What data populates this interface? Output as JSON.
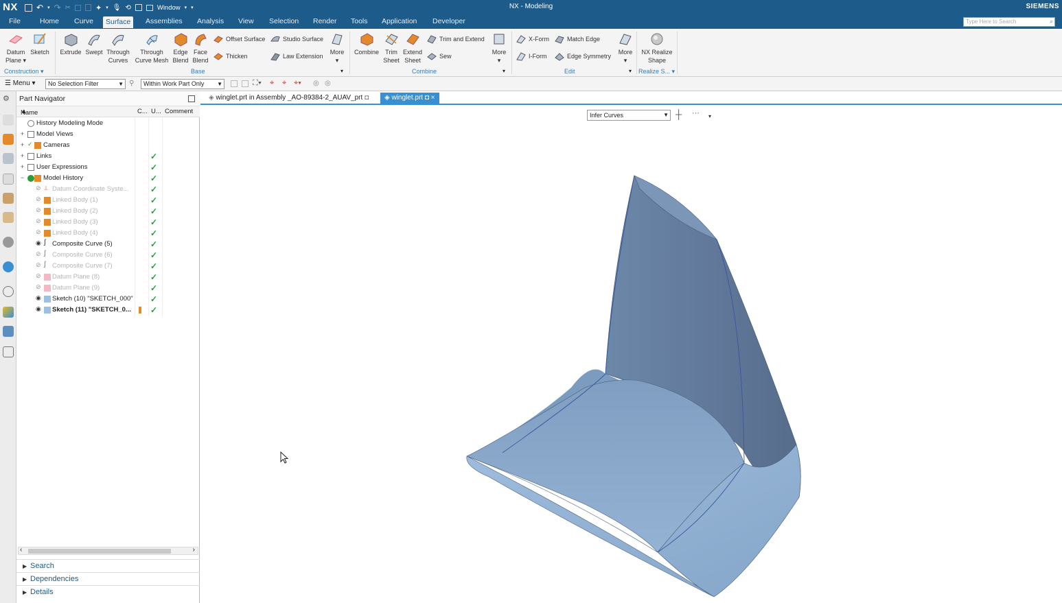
{
  "titlebar": {
    "logo": "NX",
    "window_menu": "Window",
    "title": "NX - Modeling",
    "brand": "SIEMENS"
  },
  "menu_tabs": [
    "File",
    "Home",
    "Curve",
    "Surface",
    "Assemblies",
    "Analysis",
    "View",
    "Selection",
    "Render",
    "Tools",
    "Application",
    "Developer"
  ],
  "active_tab": "Surface",
  "search": {
    "placeholder": "Type Here to Search"
  },
  "ribbon": {
    "construction": {
      "datum_plane": "Datum",
      "datum_plane2": "Plane",
      "sketch": "Sketch",
      "group": "Construction"
    },
    "base": {
      "extrude": "Extrude",
      "swept": "Swept",
      "through_curves": "Through",
      "through_curves2": "Curves",
      "through_curve_mesh": "Through",
      "through_curve_mesh2": "Curve Mesh",
      "edge_blend": "Edge",
      "edge_blend2": "Blend",
      "face_blend": "Face",
      "face_blend2": "Blend",
      "offset_surface": "Offset Surface",
      "thicken": "Thicken",
      "studio_surface": "Studio Surface",
      "law_extension": "Law Extension",
      "more": "More",
      "group": "Base"
    },
    "combine": {
      "combine": "Combine",
      "trim_sheet": "Trim",
      "trim_sheet2": "Sheet",
      "extend_sheet": "Extend",
      "extend_sheet2": "Sheet",
      "trim_and_extend": "Trim and Extend",
      "sew": "Sew",
      "more": "More",
      "group": "Combine"
    },
    "edit": {
      "xform": "X-Form",
      "iform": "I-Form",
      "match_edge": "Match Edge",
      "edge_symmetry": "Edge Symmetry",
      "more": "More",
      "group": "Edit"
    },
    "realize": {
      "label": "NX Realize",
      "label2": "Shape",
      "group": "Realize S..."
    }
  },
  "selection_bar": {
    "menu": "Menu",
    "filter": "No Selection Filter",
    "scope": "Within Work Part Only"
  },
  "navigator": {
    "title": "Part Navigator",
    "columns": {
      "name": "Name",
      "c": "C...",
      "u": "U...",
      "comment": "Comment"
    },
    "rows": [
      {
        "label": "History Modeling Mode",
        "checked": false
      },
      {
        "label": "Model Views",
        "checked": false
      },
      {
        "label": "Cameras",
        "checked": false
      },
      {
        "label": "Links",
        "checked": true
      },
      {
        "label": "User Expressions",
        "checked": true
      },
      {
        "label": "Model History",
        "checked": true
      },
      {
        "label": "Datum Coordinate Syste...",
        "checked": true
      },
      {
        "label": "Linked Body (1)",
        "checked": true
      },
      {
        "label": "Linked Body (2)",
        "checked": true
      },
      {
        "label": "Linked Body (3)",
        "checked": true
      },
      {
        "label": "Linked Body (4)",
        "checked": true
      },
      {
        "label": "Composite Curve (5)",
        "checked": true
      },
      {
        "label": "Composite Curve (6)",
        "checked": true
      },
      {
        "label": "Composite Curve (7)",
        "checked": true
      },
      {
        "label": "Datum Plane (8)",
        "checked": true
      },
      {
        "label": "Datum Plane (9)",
        "checked": true
      },
      {
        "label": "Sketch (10) \"SKETCH_000\"",
        "checked": true
      },
      {
        "label": "Sketch (11) \"SKETCH_0...",
        "checked": true
      }
    ],
    "panels": [
      "Search",
      "Dependencies",
      "Details"
    ]
  },
  "doc_tabs": [
    "winglet.prt in Assembly _AO-89384-2_AUAV_prt",
    "winglet.prt"
  ],
  "viewport": {
    "infer": "Infer Curves"
  },
  "colors": {
    "titlebar": "#1d5b8a",
    "accent": "#3a8fd0",
    "check": "#2a9d3a",
    "model": "#7a9cc0"
  }
}
